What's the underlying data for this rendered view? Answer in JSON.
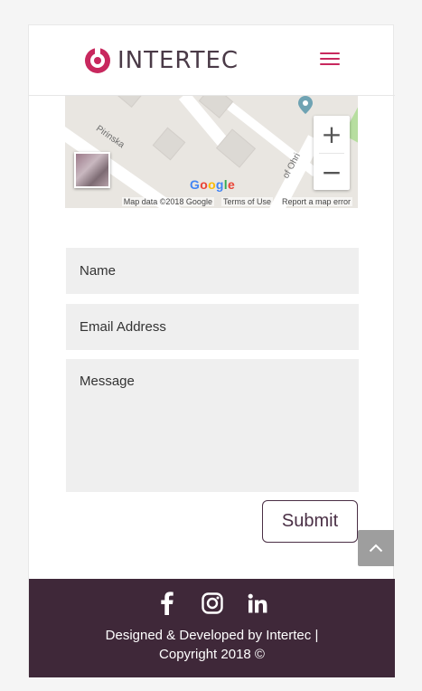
{
  "header": {
    "logo_text": "INTERTEC",
    "menu_icon": "hamburger-menu-icon",
    "accent_color": "#c8285e"
  },
  "map": {
    "street_label": "Pirinska",
    "street_label_2": "of Ohri",
    "google_text": "Google",
    "footer": {
      "data": "Map data ©2018 Google",
      "terms": "Terms of Use",
      "report": "Report a map error"
    },
    "zoom_in": "+",
    "zoom_out": "−"
  },
  "form": {
    "name_placeholder": "Name",
    "email_placeholder": "Email Address",
    "message_placeholder": "Message",
    "submit_label": "Submit"
  },
  "footer": {
    "icons": [
      "facebook-icon",
      "instagram-icon",
      "linkedin-icon"
    ],
    "line1": "Designed & Developed by Intertec |",
    "line2": "Copyright 2018 ©",
    "bg_color": "#3f2839"
  },
  "scroll_top_icon": "chevron-up-icon"
}
